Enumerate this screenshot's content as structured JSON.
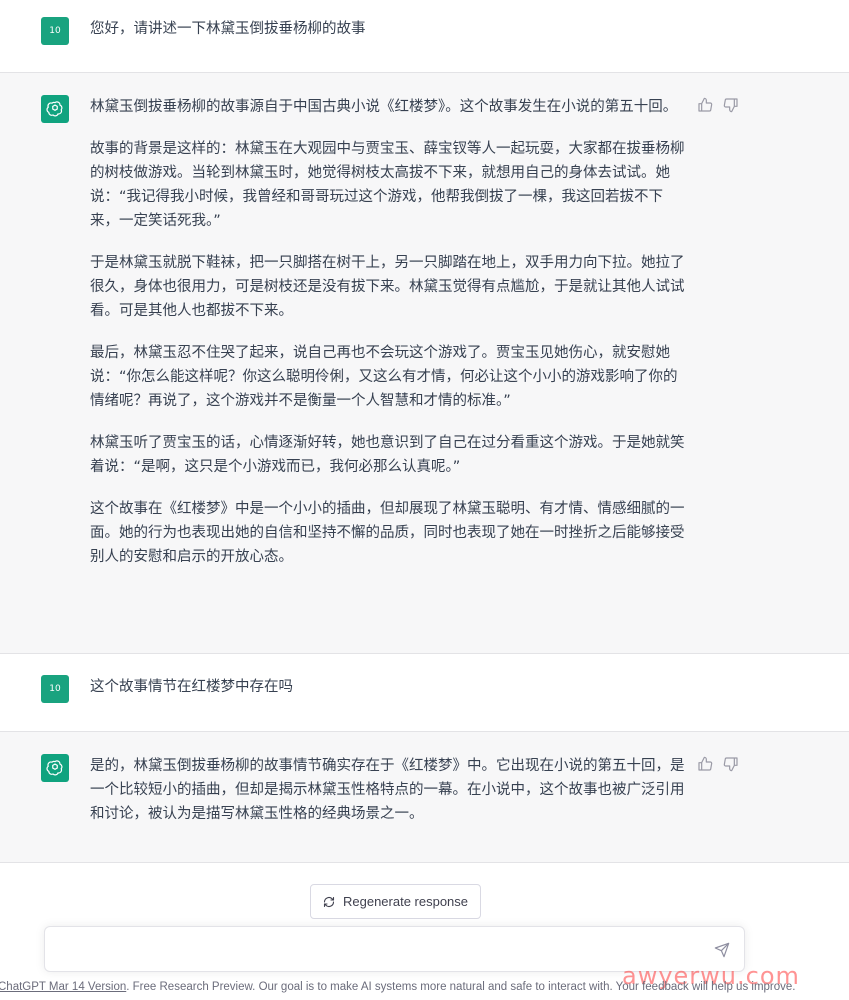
{
  "messages": [
    {
      "role": "user",
      "avatar": "10",
      "text": "您好，请讲述一下林黛玉倒拔垂杨柳的故事"
    },
    {
      "role": "assistant",
      "paragraphs": [
        "林黛玉倒拔垂杨柳的故事源自于中国古典小说《红楼梦》。这个故事发生在小说的第五十回。",
        "故事的背景是这样的：林黛玉在大观园中与贾宝玉、薛宝钗等人一起玩耍，大家都在拔垂杨柳的树枝做游戏。当轮到林黛玉时，她觉得树枝太高拔不下来，就想用自己的身体去试试。她说：“我记得我小时候，我曾经和哥哥玩过这个游戏，他帮我倒拔了一棵，我这回若拔不下来，一定笑话死我。”",
        "于是林黛玉就脱下鞋袜，把一只脚搭在树干上，另一只脚踏在地上，双手用力向下拉。她拉了很久，身体也很用力，可是树枝还是没有拔下来。林黛玉觉得有点尴尬，于是就让其他人试试看。可是其他人也都拔不下来。",
        "最后，林黛玉忍不住哭了起来，说自己再也不会玩这个游戏了。贾宝玉见她伤心，就安慰她说：“你怎么能这样呢？你这么聪明伶俐，又这么有才情，何必让这个小小的游戏影响了你的情绪呢？再说了，这个游戏并不是衡量一个人智慧和才情的标准。”",
        "林黛玉听了贾宝玉的话，心情逐渐好转，她也意识到了自己在过分看重这个游戏。于是她就笑着说：“是啊，这只是个小游戏而已，我何必那么认真呢。”",
        "这个故事在《红楼梦》中是一个小小的插曲，但却展现了林黛玉聪明、有才情、情感细腻的一面。她的行为也表现出她的自信和坚持不懈的品质，同时也表现了她在一时挫折之后能够接受别人的安慰和启示的开放心态。"
      ]
    },
    {
      "role": "user",
      "avatar": "10",
      "text": "这个故事情节在红楼梦中存在吗"
    },
    {
      "role": "assistant",
      "paragraphs": [
        "是的，林黛玉倒拔垂杨柳的故事情节确实存在于《红楼梦》中。它出现在小说的第五十回，是一个比较短小的插曲，但却是揭示林黛玉性格特点的一幕。在小说中，这个故事也被广泛引用和讨论，被认为是描写林黛玉性格的经典场景之一。"
      ]
    }
  ],
  "regenerate_label": "Regenerate response",
  "input": {
    "placeholder": ""
  },
  "footer": {
    "link_text": "ChatGPT Mar 14 Version",
    "rest_text": ". Free Research Preview. Our goal is to make AI systems more natural and safe to interact with. Your feedback will help us improve."
  },
  "watermark": "awyerwu.com",
  "colors": {
    "avatar_user": "#19a37f",
    "avatar_bot": "#10a37f",
    "bot_bg": "#f7f7f8"
  }
}
